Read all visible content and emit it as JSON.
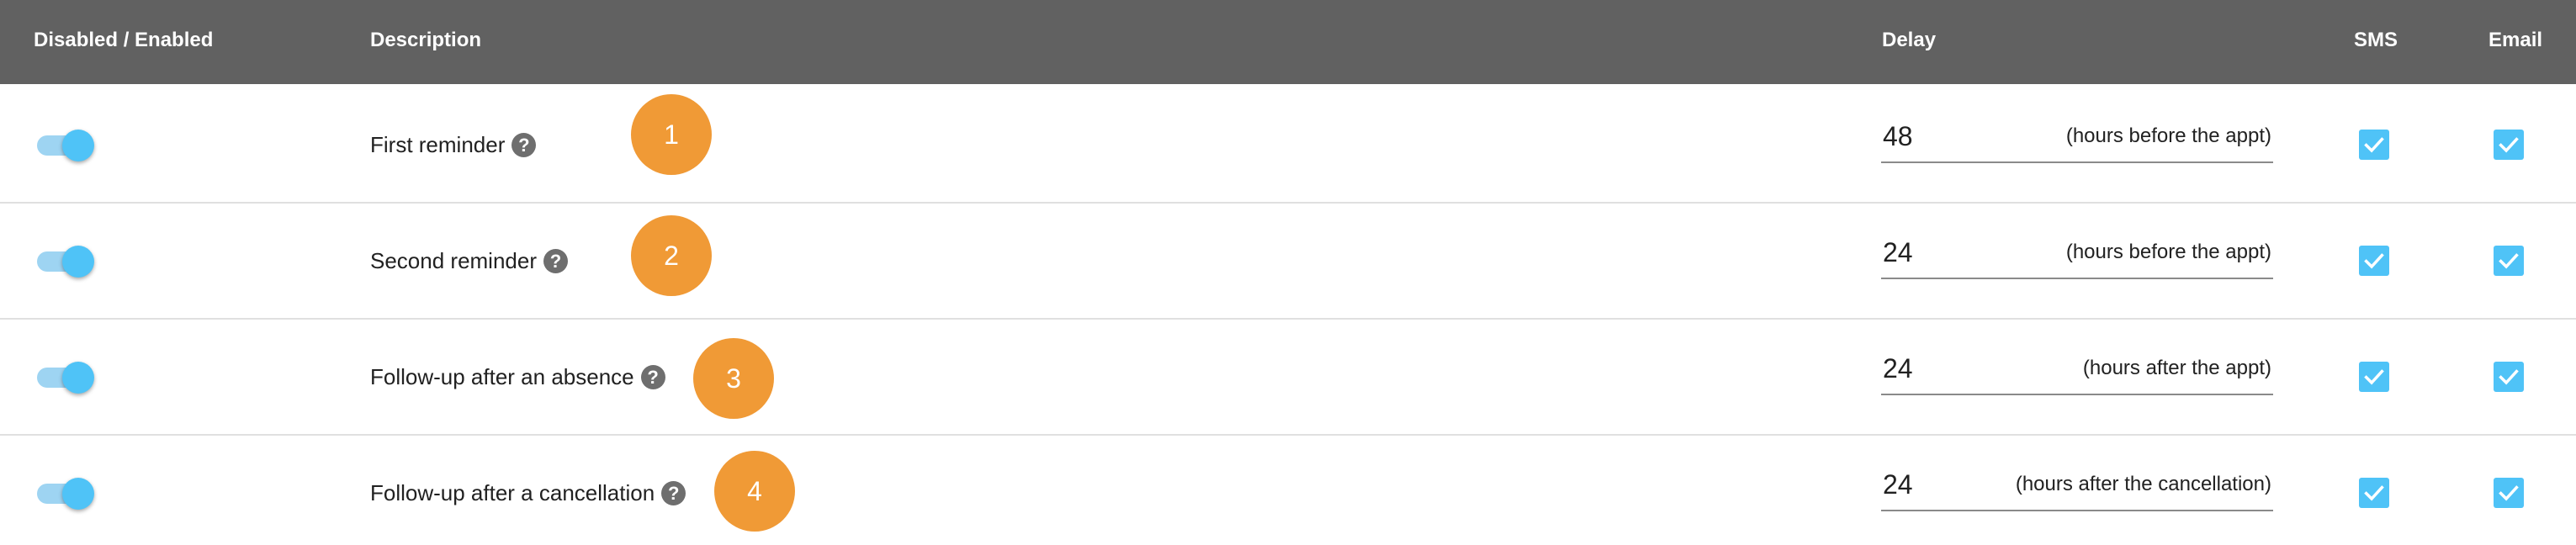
{
  "header": {
    "toggle_col": "Disabled / Enabled",
    "description_col": "Description",
    "delay_col": "Delay",
    "sms_col": "SMS",
    "email_col": "Email"
  },
  "accent_color": "#4fc3f7",
  "badge_color": "#f09a36",
  "header_color": "#616161",
  "help_icon_glyph": "?",
  "rows": [
    {
      "enabled": true,
      "label": "First reminder",
      "badge": "1",
      "delay_value": "48",
      "delay_unit": "(hours before the appt)",
      "sms": true,
      "email": true
    },
    {
      "enabled": true,
      "label": "Second reminder",
      "badge": "2",
      "delay_value": "24",
      "delay_unit": "(hours before the appt)",
      "sms": true,
      "email": true
    },
    {
      "enabled": true,
      "label": "Follow-up after an absence",
      "badge": "3",
      "delay_value": "24",
      "delay_unit": "(hours after the appt)",
      "sms": true,
      "email": true
    },
    {
      "enabled": true,
      "label": "Follow-up after a cancellation",
      "badge": "4",
      "delay_value": "24",
      "delay_unit": "(hours after the cancellation)",
      "sms": true,
      "email": true
    }
  ]
}
